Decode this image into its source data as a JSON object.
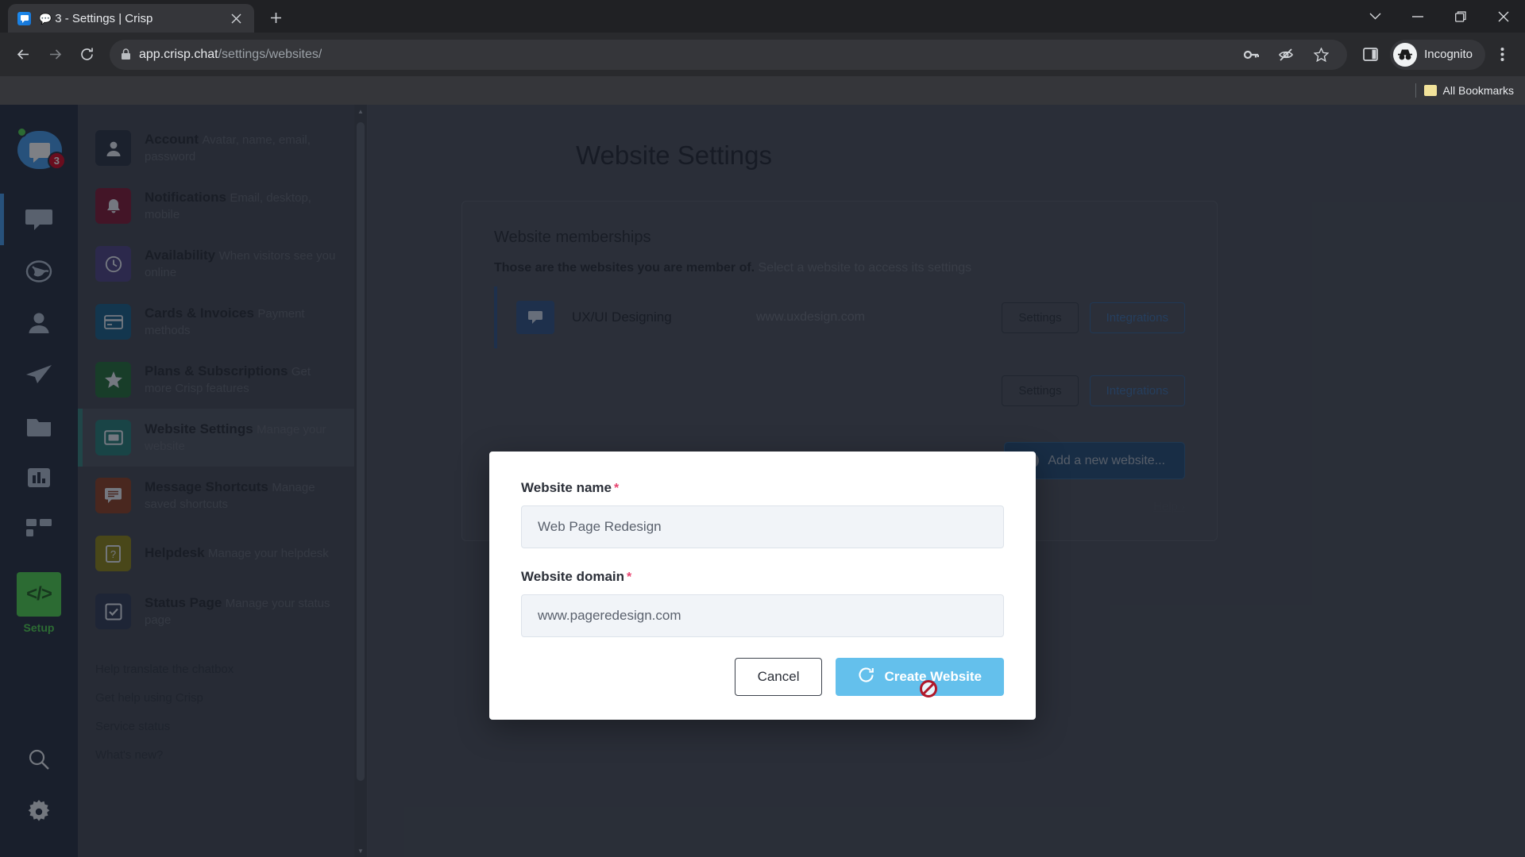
{
  "browser": {
    "tab": {
      "bubble_icon": "chat-bubble-icon",
      "title": "3 - Settings | Crisp",
      "close_label": "✕"
    },
    "new_tab_label": "+",
    "window_controls": {
      "minimize": "—",
      "maximize": "❐",
      "close": "✕",
      "chevron": "⌄"
    },
    "nav": {
      "back": "←",
      "forward": "→",
      "reload": "⟳"
    },
    "omnibox": {
      "lock_icon": "lock-icon",
      "url_domain": "app.crisp.chat",
      "url_path": "/settings/websites/",
      "actions": [
        "key-icon",
        "eye-slash-icon",
        "star-icon"
      ]
    },
    "side_panel_icon": "side-panel-icon",
    "profile": {
      "name": "Incognito",
      "avatar_icon": "incognito-icon"
    },
    "menu_icon": "kebab-menu-icon",
    "bookmarks": {
      "label": "All Bookmarks",
      "folder_icon": "folder-icon"
    }
  },
  "rail": {
    "avatar": {
      "status": "online",
      "badge": "3",
      "icon": "chat-avatar-icon"
    },
    "items": [
      {
        "name": "inbox",
        "icon": "chat-bubble-icon",
        "active": true
      },
      {
        "name": "visitors",
        "icon": "globe-icon",
        "active": false
      },
      {
        "name": "contacts",
        "icon": "person-icon",
        "active": false
      },
      {
        "name": "campaigns",
        "icon": "paper-plane-icon",
        "active": false
      },
      {
        "name": "knowledge",
        "icon": "book-icon",
        "active": false
      },
      {
        "name": "analytics",
        "icon": "bar-chart-icon",
        "active": false
      },
      {
        "name": "plugins",
        "icon": "grid-icon",
        "active": false
      }
    ],
    "setup": {
      "label": "Setup",
      "icon": "code-icon"
    },
    "bottom": [
      {
        "name": "search",
        "icon": "search-icon"
      },
      {
        "name": "settings",
        "icon": "gear-icon"
      }
    ]
  },
  "sidebar": {
    "items": [
      {
        "title": "Account",
        "sub": "Avatar, name, email, password",
        "icon": "person-icon",
        "color": "#252d3d",
        "active": false
      },
      {
        "title": "Notifications",
        "sub": "Email, desktop, mobile",
        "icon": "bell-icon",
        "color": "#7d1330",
        "active": false
      },
      {
        "title": "Availability",
        "sub": "When visitors see you online",
        "icon": "clock-icon",
        "color": "#4a3f80",
        "active": false
      },
      {
        "title": "Cards & Invoices",
        "sub": "Payment methods",
        "icon": "credit-card-icon",
        "color": "#125b86",
        "active": false
      },
      {
        "title": "Plans & Subscriptions",
        "sub": "Get more Crisp features",
        "icon": "star-icon",
        "color": "#1d6b33",
        "active": false
      },
      {
        "title": "Website Settings",
        "sub": "Manage your website",
        "icon": "monitor-icon",
        "color": "#1f7a73",
        "active": true
      },
      {
        "title": "Message Shortcuts",
        "sub": "Manage saved shortcuts",
        "icon": "message-icon",
        "color": "#8a3a1e",
        "active": false
      },
      {
        "title": "Helpdesk",
        "sub": "Manage your helpdesk",
        "icon": "help-icon",
        "color": "#8a8010",
        "active": false
      },
      {
        "title": "Status Page",
        "sub": "Manage your status page",
        "icon": "check-icon",
        "color": "#2c3750",
        "active": false
      }
    ],
    "links": [
      "Help translate the chatbox",
      "Get help using Crisp",
      "Service status",
      "What's new?"
    ]
  },
  "main": {
    "page_title": "Website Settings",
    "card": {
      "heading": "Website memberships",
      "sub_strong": "Those are the websites you are member of.",
      "sub_rest": " Select a website to access its settings",
      "websites": [
        {
          "name": "UX/UI Designing",
          "domain": "www.uxdesign.com",
          "settings_label": "Settings",
          "integrations_label": "Integrations"
        },
        {
          "name": "",
          "domain": "",
          "settings_label": "Settings",
          "integrations_label": "Integrations"
        }
      ],
      "add_button": "Add a new website...",
      "help_link": "Help ›"
    }
  },
  "modal": {
    "name_label": "Website name",
    "name_required": "*",
    "name_value": "Web Page Redesign",
    "name_placeholder": "Website name",
    "domain_label": "Website domain",
    "domain_required": "*",
    "domain_value": "www.pageredesign.com",
    "domain_placeholder": "Website domain",
    "cancel_label": "Cancel",
    "create_label": "Create Website",
    "create_icon": "loading-spinner-icon",
    "cursor_icon": "not-allowed-cursor"
  },
  "colors": {
    "accent_blue": "#3e97e8",
    "create_button": "#64c0ec",
    "badge_red": "#d0021b",
    "online_green": "#4ad14a",
    "active_teal": "#2f7f78",
    "required_pink": "#e8436f"
  }
}
